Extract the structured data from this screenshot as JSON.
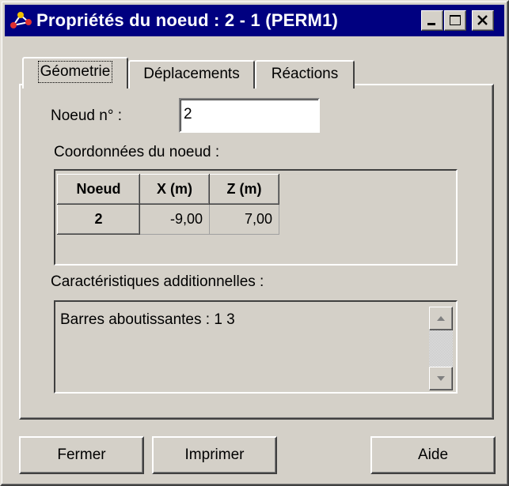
{
  "window": {
    "title": "Propriétés du noeud : 2 - 1 (PERM1)",
    "icon": "node-graph-icon"
  },
  "tabs": [
    {
      "label": "Géometrie",
      "active": true
    },
    {
      "label": "Déplacements",
      "active": false
    },
    {
      "label": "Réactions",
      "active": false
    }
  ],
  "node": {
    "label": "Noeud n° :",
    "value": "2"
  },
  "coordinates": {
    "label": "Coordonnées du noeud :",
    "columns": [
      "Noeud",
      "X (m)",
      "Z (m)"
    ],
    "rows": [
      {
        "noeud": "2",
        "x": "-9,00",
        "z": "7,00"
      }
    ]
  },
  "additional": {
    "label": "Caractéristiques additionnelles :",
    "text": "Barres aboutissantes : 1 3"
  },
  "buttons": {
    "close": "Fermer",
    "print": "Imprimer",
    "help": "Aide"
  },
  "colors": {
    "titlebar": "#000080",
    "face": "#d4d0c8"
  }
}
